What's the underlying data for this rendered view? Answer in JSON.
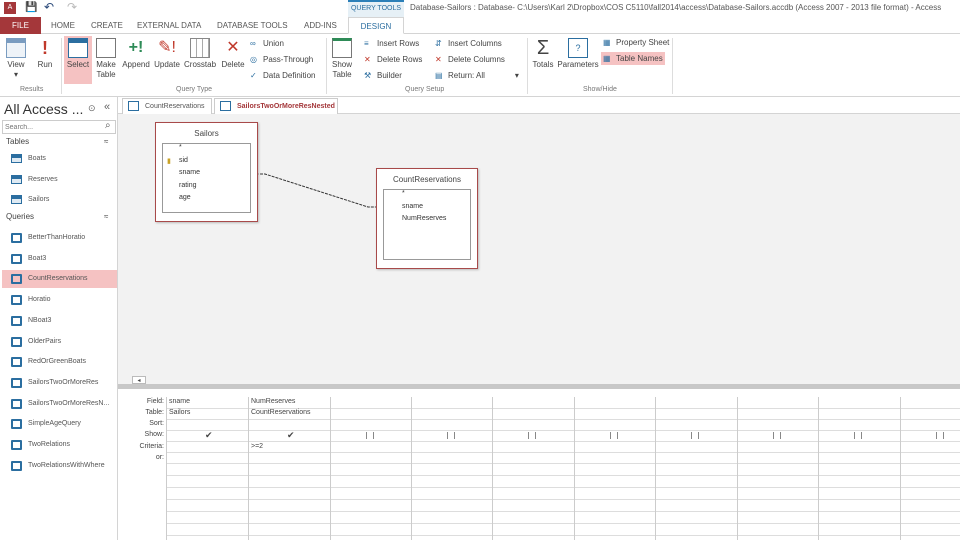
{
  "titlebar": {
    "context_tab": "QUERY TOOLS",
    "title": "Database-Sailors : Database- C:\\Users\\Karl 2\\Dropbox\\COS C5110\\fall2014\\access\\Database-Sailors.accdb (Access 2007 - 2013 file format) - Access"
  },
  "menu_tabs": [
    "FILE",
    "HOME",
    "CREATE",
    "EXTERNAL DATA",
    "DATABASE TOOLS",
    "ADD-INS",
    "DESIGN"
  ],
  "ribbon": {
    "results": {
      "label": "Results",
      "view": "View",
      "run": "Run"
    },
    "query_type": {
      "label": "Query Type",
      "select": "Select",
      "make_table": "Make Table",
      "append": "Append",
      "update": "Update",
      "crosstab": "Crosstab",
      "delete": "Delete",
      "union": "Union",
      "pass_through": "Pass-Through",
      "data_definition": "Data Definition"
    },
    "query_setup": {
      "label": "Query Setup",
      "show_table": "Show Table",
      "insert_rows": "Insert Rows",
      "delete_rows": "Delete Rows",
      "builder": "Builder",
      "insert_columns": "Insert Columns",
      "delete_columns": "Delete Columns",
      "return_label": "Return:",
      "return_value": "All"
    },
    "show_hide": {
      "label": "Show/Hide",
      "totals": "Totals",
      "parameters": "Parameters",
      "property_sheet": "Property Sheet",
      "table_names": "Table Names"
    }
  },
  "nav": {
    "title": "All Access ...",
    "search_placeholder": "Search...",
    "tables_header": "Tables",
    "tables": [
      "Boats",
      "Reserves",
      "Sailors"
    ],
    "queries_header": "Queries",
    "queries": [
      "BetterThanHoratio",
      "Boat3",
      "CountReservations",
      "Horatio",
      "NBoat3",
      "OlderPairs",
      "RedOrGreenBoats",
      "SailorsTwoOrMoreRes",
      "SailorsTwoOrMoreResN...",
      "SimpleAgeQuery",
      "TwoRelations",
      "TwoRelationsWithWhere"
    ],
    "selected": "CountReservations"
  },
  "doc_tabs": [
    "CountReservations",
    "SailorsTwoOrMoreResNested"
  ],
  "tables": [
    {
      "name": "Sailors",
      "fields": [
        "*",
        "sid",
        "sname",
        "rating",
        "age"
      ]
    },
    {
      "name": "CountReservations",
      "fields": [
        "*",
        "sname",
        "NumReserves"
      ]
    }
  ],
  "grid": {
    "row_labels": [
      "Field:",
      "Table:",
      "Sort:",
      "Show:",
      "Criteria:",
      "or:"
    ],
    "columns": [
      {
        "field": "sname",
        "table": "Sailors",
        "show": true,
        "criteria": ""
      },
      {
        "field": "NumReserves",
        "table": "CountReservations",
        "show": true,
        "criteria": ">=2"
      }
    ]
  }
}
